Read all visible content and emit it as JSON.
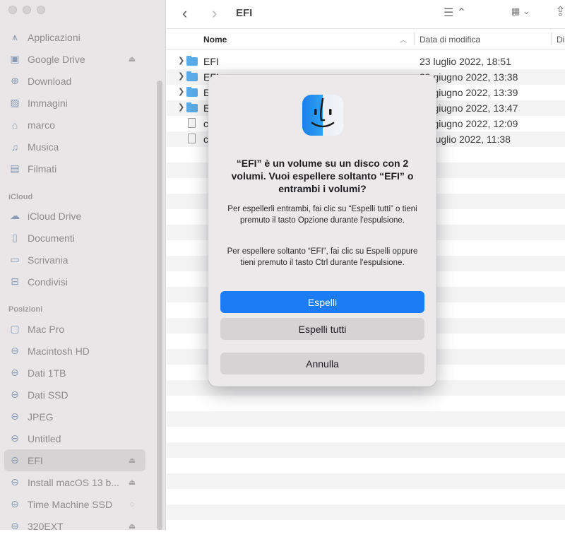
{
  "sidebar": {
    "favorites": [
      {
        "label": "Applicazioni",
        "icon": "applications-icon",
        "eject": false
      },
      {
        "label": "Google Drive",
        "icon": "drive-folder-icon",
        "eject": true
      },
      {
        "label": "Download",
        "icon": "download-icon",
        "eject": false
      },
      {
        "label": "Immagini",
        "icon": "photo-icon",
        "eject": false
      },
      {
        "label": "marco",
        "icon": "home-icon",
        "eject": false
      },
      {
        "label": "Musica",
        "icon": "music-icon",
        "eject": false
      },
      {
        "label": "Filmati",
        "icon": "film-icon",
        "eject": false
      }
    ],
    "icloud_header": "iCloud",
    "icloud": [
      {
        "label": "iCloud Drive",
        "icon": "cloud-icon"
      },
      {
        "label": "Documenti",
        "icon": "document-icon"
      },
      {
        "label": "Scrivania",
        "icon": "desktop-icon"
      },
      {
        "label": "Condivisi",
        "icon": "shared-folder-icon"
      }
    ],
    "locations_header": "Posizioni",
    "locations": [
      {
        "label": "Mac Pro",
        "icon": "computer-icon",
        "eject": false,
        "selected": false
      },
      {
        "label": "Macintosh HD",
        "icon": "disk-icon",
        "eject": false,
        "selected": false
      },
      {
        "label": "Dati 1TB",
        "icon": "disk-icon",
        "eject": false,
        "selected": false
      },
      {
        "label": "Dati SSD",
        "icon": "disk-icon",
        "eject": false,
        "selected": false
      },
      {
        "label": "JPEG",
        "icon": "disk-icon",
        "eject": false,
        "selected": false
      },
      {
        "label": "Untitled",
        "icon": "disk-icon",
        "eject": false,
        "selected": false
      },
      {
        "label": "EFI",
        "icon": "disk-icon",
        "eject": true,
        "selected": true
      },
      {
        "label": "Install macOS 13 b...",
        "icon": "disk-icon",
        "eject": true,
        "selected": false
      },
      {
        "label": "Time Machine SSD",
        "icon": "disk-icon",
        "eject": false,
        "selected": false
      },
      {
        "label": "320EXT",
        "icon": "disk-icon",
        "eject": true,
        "selected": false
      }
    ]
  },
  "toolbar": {
    "title": "EFI",
    "back": "‹",
    "forward": "›",
    "list_view": "☰ ⌃",
    "grid_view": "▦ ⌄",
    "share": "⇪"
  },
  "columns": {
    "name": "Nome",
    "date": "Data di modifica",
    "third": "Di"
  },
  "files": [
    {
      "name": "EFI",
      "date": "23 luglio 2022, 18:51",
      "type": "folder"
    },
    {
      "name": "EFI",
      "date": "29 giugno 2022, 13:38",
      "type": "folder"
    },
    {
      "name": "E",
      "date": "29 giugno 2022, 13:39",
      "type": "folder"
    },
    {
      "name": "E",
      "date": "29 giugno 2022, 13:47",
      "type": "folder"
    },
    {
      "name": "c",
      "date": "29 giugno 2022, 12:09",
      "type": "file"
    },
    {
      "name": "c",
      "date": "23 luglio 2022, 11:38",
      "type": "file"
    }
  ],
  "dialog": {
    "title": "“EFI” è un volume su un disco con 2 volumi. Vuoi espellere soltanto “EFI” o entrambi i volumi?",
    "p1": "Per espellerli entrambi, fai clic su “Espelli tutti” o tieni premuto il tasto Opzione durante l'espulsione.",
    "p2": "Per espellere soltanto “EFI”, fai clic su Espelli oppure tieni premuto il tasto Ctrl durante l'espulsione.",
    "btn_eject": "Espelli",
    "btn_eject_all": "Espelli tutti",
    "btn_cancel": "Annulla"
  }
}
